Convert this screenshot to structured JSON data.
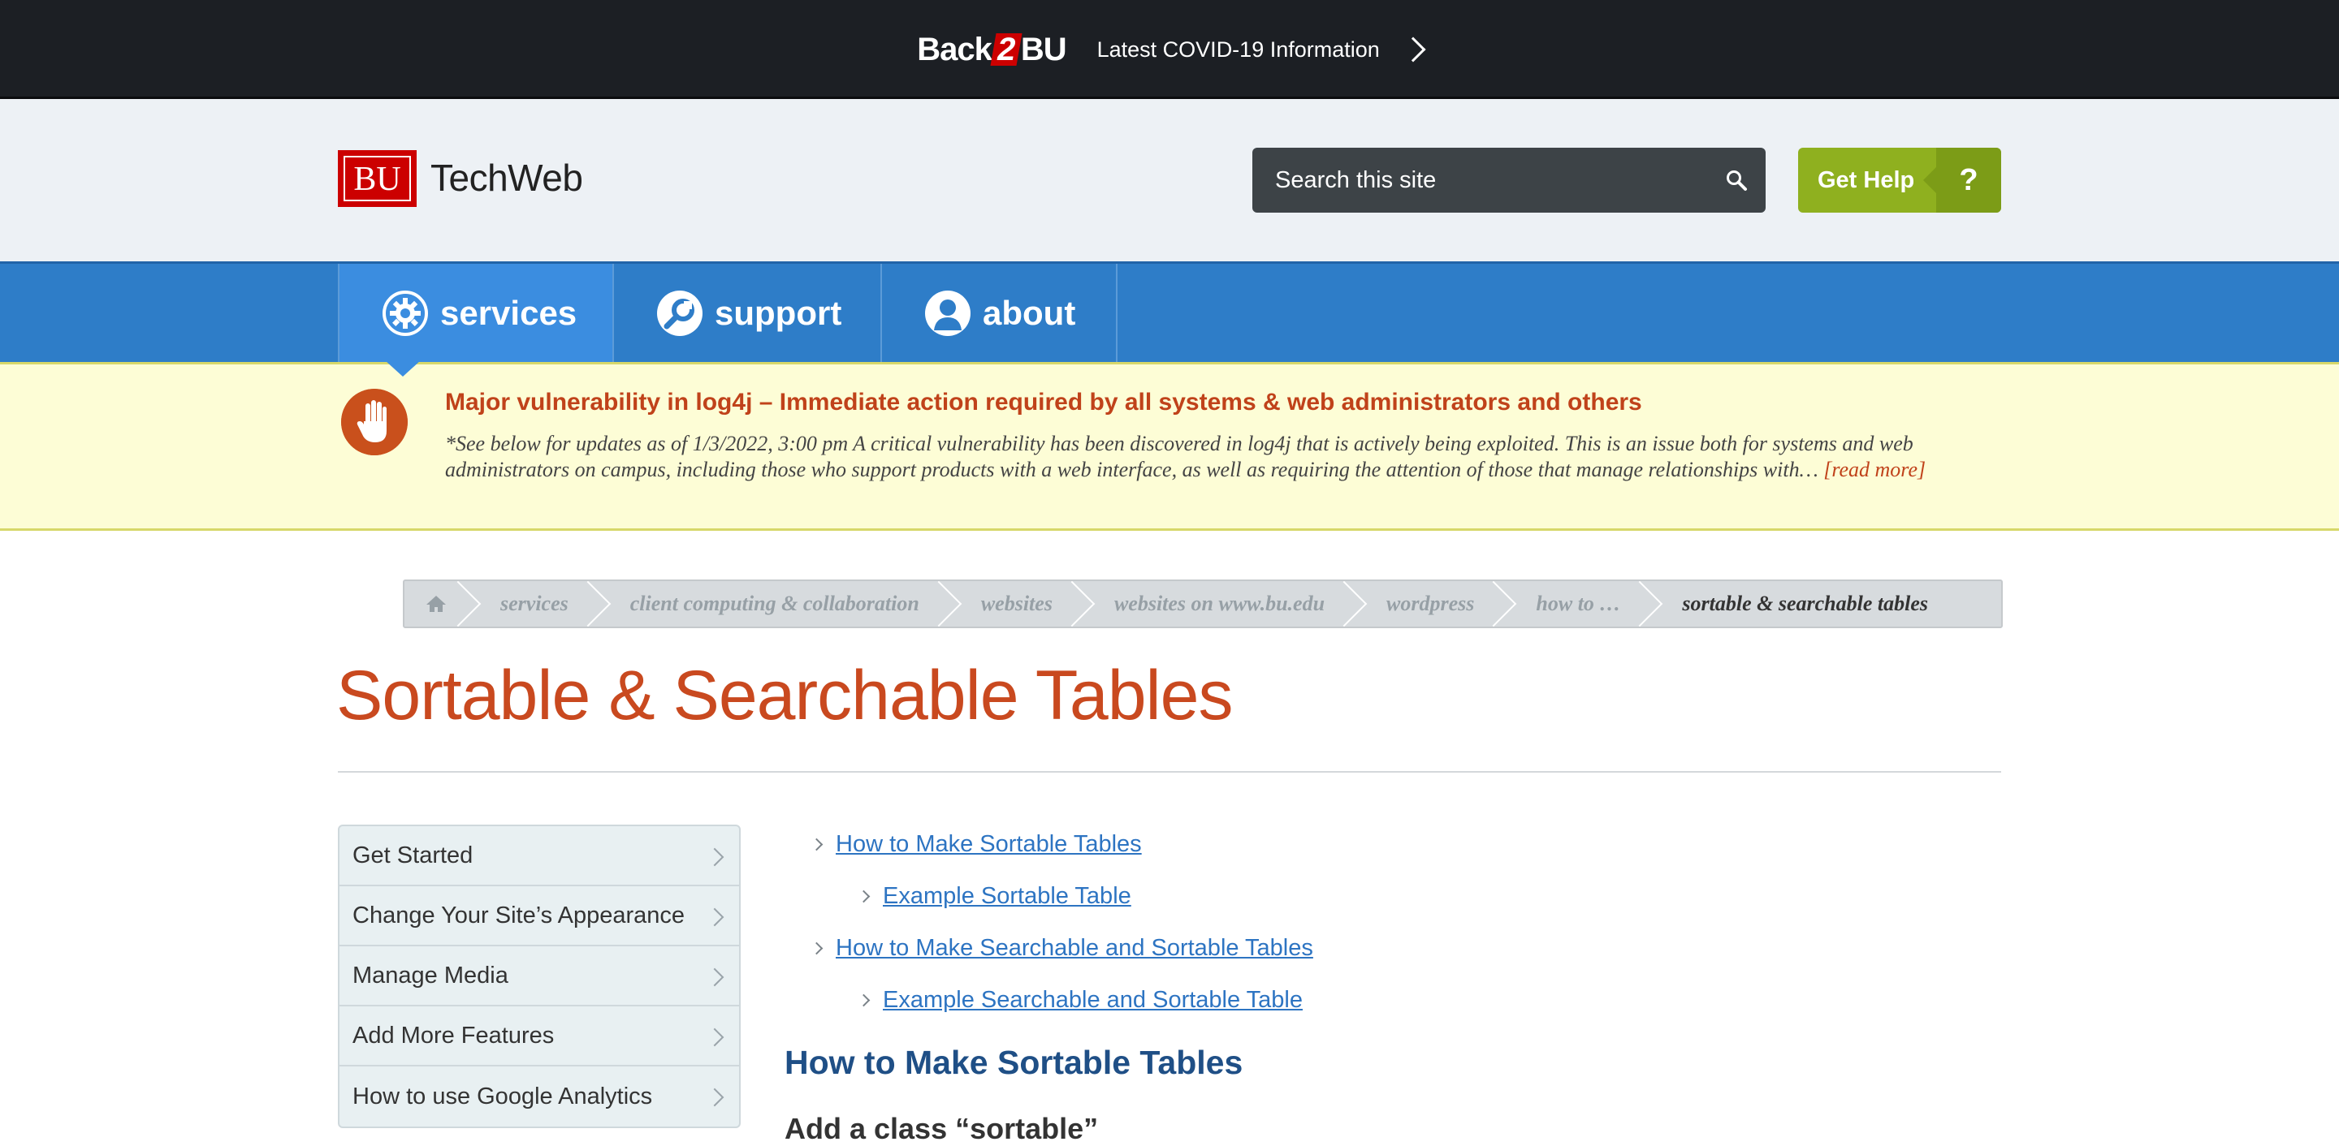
{
  "topbar": {
    "logo_left": "Back",
    "logo_mid": "2",
    "logo_right": "BU",
    "covid_link": "Latest COVID-19 Information"
  },
  "header": {
    "logo_text": "BU",
    "site_name": "TechWeb",
    "search_placeholder": "Search this site",
    "help_label": "Get Help",
    "help_icon_text": "?"
  },
  "nav": {
    "items": [
      {
        "label": "services",
        "icon": "gear-icon",
        "active": true
      },
      {
        "label": "support",
        "icon": "wrench-icon",
        "active": false
      },
      {
        "label": "about",
        "icon": "person-icon",
        "active": false
      }
    ]
  },
  "alert": {
    "icon": "stop-hand-icon",
    "title": "Major vulnerability in log4j – Immediate action required by all systems & web administrators and others",
    "body": "*See below for updates as of 1/3/2022, 3:00 pm A critical vulnerability has been discovered in log4j that is actively being exploited. This is an issue both for systems and web administrators on campus, including those who support products with a web interface, as well as requiring the attention of those that manage relationships with…",
    "more": "[read more]"
  },
  "breadcrumb": {
    "items": [
      "services",
      "client computing & collaboration",
      "websites",
      "websites on www.bu.edu",
      "wordpress",
      "how to …",
      "sortable & searchable tables"
    ]
  },
  "page": {
    "title": "Sortable & Searchable Tables"
  },
  "sidebar": {
    "items": [
      {
        "label": "Get Started"
      },
      {
        "label": "Change Your Site’s Appearance"
      },
      {
        "label": "Manage Media"
      },
      {
        "label": "Add More Features"
      },
      {
        "label": "How to use Google Analytics"
      }
    ]
  },
  "toc": {
    "items": [
      {
        "label": "How to Make Sortable Tables",
        "level": 1
      },
      {
        "label": "Example Sortable Table",
        "level": 2
      },
      {
        "label": "How to Make Searchable and Sortable Tables",
        "level": 1
      },
      {
        "label": "Example Searchable and Sortable Table",
        "level": 2
      }
    ]
  },
  "content": {
    "section_heading": "How to Make Sortable Tables",
    "clipped_heading": "Add a class “sortable”"
  },
  "colors": {
    "topbar": "#1c1f24",
    "header_bg": "#edf1f5",
    "nav_blue": "#2e7dc8",
    "nav_active": "#3b8de0",
    "alert_bg": "#fdfdd6",
    "alert_red": "#c0421a",
    "help_green": "#8fb01f",
    "title_orange": "#c9491f",
    "link_blue": "#2d74c2"
  }
}
